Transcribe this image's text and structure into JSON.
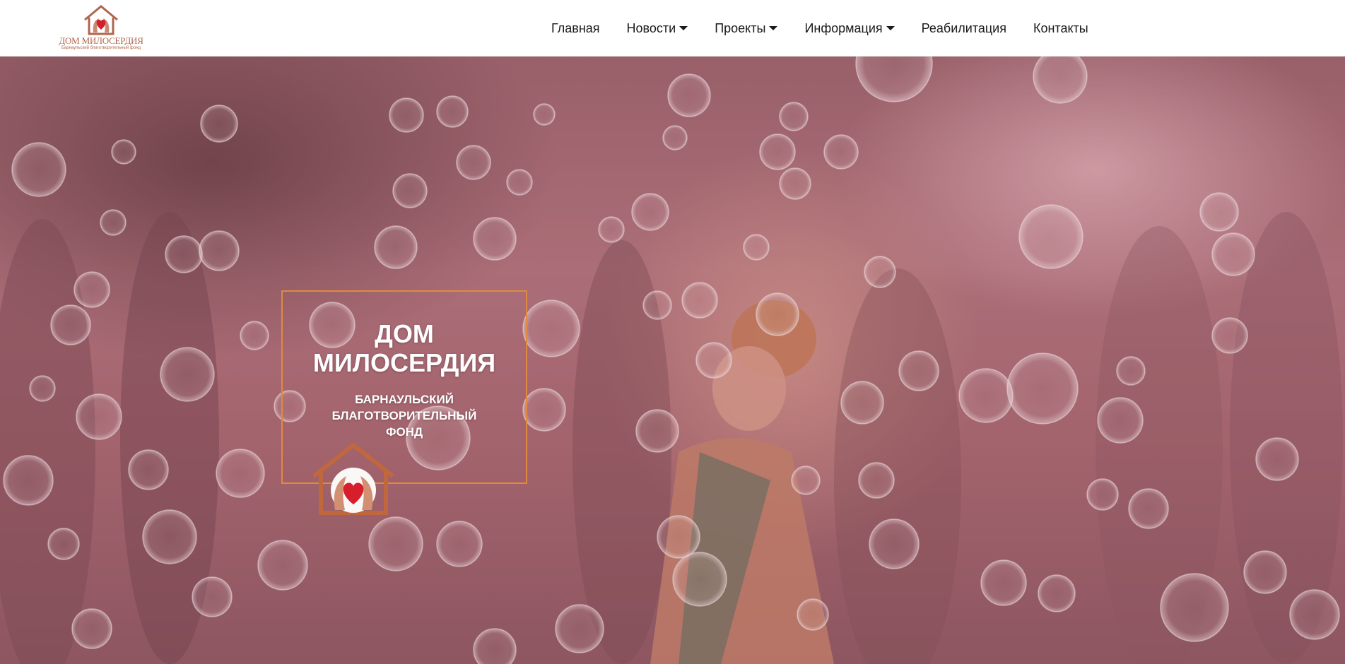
{
  "header": {
    "logo": {
      "title": "ДОМ МИЛОСЕРДИЯ",
      "subtitle": "Барнаульский благотворительный фонд",
      "icon": "house-heart-icon"
    },
    "nav": [
      {
        "label": "Главная",
        "dropdown": false
      },
      {
        "label": "Новости",
        "dropdown": true
      },
      {
        "label": "Проекты",
        "dropdown": true
      },
      {
        "label": "Информация",
        "dropdown": true
      },
      {
        "label": "Реабилитация",
        "dropdown": false
      },
      {
        "label": "Контакты",
        "dropdown": false
      }
    ]
  },
  "hero": {
    "title_line1": "ДОМ",
    "title_line2": "МИЛОСЕРДИЯ",
    "subtitle_line1": "БАРНАУЛЬСКИЙ",
    "subtitle_line2": "БЛАГОТВОРИТЕЛЬНЫЙ",
    "subtitle_line3": "ФОНД",
    "emblem_icon": "house-hands-heart-icon",
    "frame_color": "#e08a3e",
    "overlay_color": "#a8636e"
  }
}
